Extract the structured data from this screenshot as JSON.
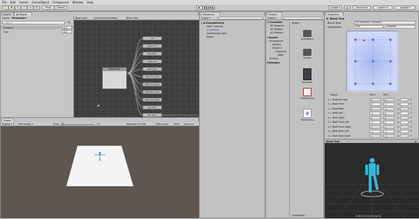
{
  "menu": [
    "File",
    "Edit",
    "Assets",
    "GameObject",
    "Component",
    "Window",
    "Help"
  ],
  "toolbar": {
    "pivot": "Pivot",
    "global": "Global",
    "collab": "Collab ▾",
    "account": "Account ▾",
    "layers": "Layers ▾",
    "layout": "Layout ▾"
  },
  "animator": {
    "tabs": [
      "Scene",
      "Animator"
    ],
    "sub_tabs": [
      "Layers",
      "Parameters"
    ],
    "breadcrumb": [
      "Base Layer",
      "Unarmed Locomotion",
      "Blend Tree"
    ],
    "search_placeholder": "Name",
    "params": [
      {
        "name": "Forward",
        "value": "0.0"
      },
      {
        "name": "Turn",
        "value": "0.0"
      }
    ],
    "center_node": "Blend Tree",
    "nodes": [
      "Idle",
      "Walk Front",
      "Walk Back",
      "Walk Left",
      "Walk Right",
      "Walk Front Left",
      "Walk Front Right",
      "Walk Back Left",
      "Walk Back Right",
      "Run Front",
      "Run Back"
    ],
    "footer": "MainAnimatorController.controller"
  },
  "game": {
    "tab": "Game",
    "display": "Display 1 ▾",
    "aspect": "Free Aspect ▾",
    "scale_label": "Scale",
    "scale_value": "1x",
    "options": [
      "Maximize On Play",
      "Mute Audio",
      "Stats",
      "Gizmos ▾"
    ]
  },
  "hierarchy": {
    "tab": "Hierarchy",
    "create": "Create ▾",
    "scene": "SampleScene",
    "items": [
      "Main Camera",
      "Character",
      "Directional Light",
      "Plane"
    ]
  },
  "project": {
    "tab": "Project",
    "create": "Create ▾",
    "favorites_label": "Favorites",
    "favorites": [
      "All Material",
      "All Models",
      "All Prefabs"
    ],
    "assets_label": "Assets",
    "tree": [
      "Animations",
      "Normal",
      "Strafe 4",
      "Unarmed",
      "Walk",
      "Scenes"
    ],
    "packages_label": "Packages",
    "breadcrumb": "Assets",
    "grid_items": [
      {
        "name": "Animations",
        "kind": "folder"
      },
      {
        "name": "Scenes",
        "kind": "folder"
      },
      {
        "name": "Character",
        "kind": "prefab"
      },
      {
        "name": "MainAnima...",
        "kind": "controller"
      },
      {
        "name": "MainChara...",
        "kind": "script"
      }
    ],
    "footer_path": "Assets/Mai..."
  },
  "inspector": {
    "tab": "Inspector",
    "title": "Blend Tree",
    "blend_type_label": "Blend Type",
    "blend_type_value": "2D Freeform Cartesian",
    "parameters_label": "Parameters",
    "param_x": "Turn",
    "param_y": "Forward",
    "motion_header": [
      "Motion",
      "Pos X",
      "Pos Y"
    ],
    "motions": [
      {
        "name": "Unarmed Idle",
        "x": "0",
        "y": "0"
      },
      {
        "name": "Walk Front",
        "x": "0",
        "y": "1"
      },
      {
        "name": "Walk Back",
        "x": "0",
        "y": "-1"
      },
      {
        "name": "Walk Left",
        "x": "-1",
        "y": "0"
      },
      {
        "name": "Walk Right",
        "x": "1",
        "y": "0"
      },
      {
        "name": "Walk Front Left",
        "x": "-1",
        "y": "1"
      },
      {
        "name": "Walk Front Right",
        "x": "1",
        "y": "1"
      },
      {
        "name": "Walk Back Left",
        "x": "-1",
        "y": "-1"
      },
      {
        "name": "Walk Back Right",
        "x": "1",
        "y": "-1"
      }
    ],
    "preview_label": "Blend Tree",
    "preview_footer": "0:18 (29.2%) Frame 18"
  },
  "colors": {
    "accent": "#2f82d8",
    "blend_bg": "#b8c6f6",
    "preview_bg": "#2a2a2a",
    "figure": "#33b8d8"
  }
}
